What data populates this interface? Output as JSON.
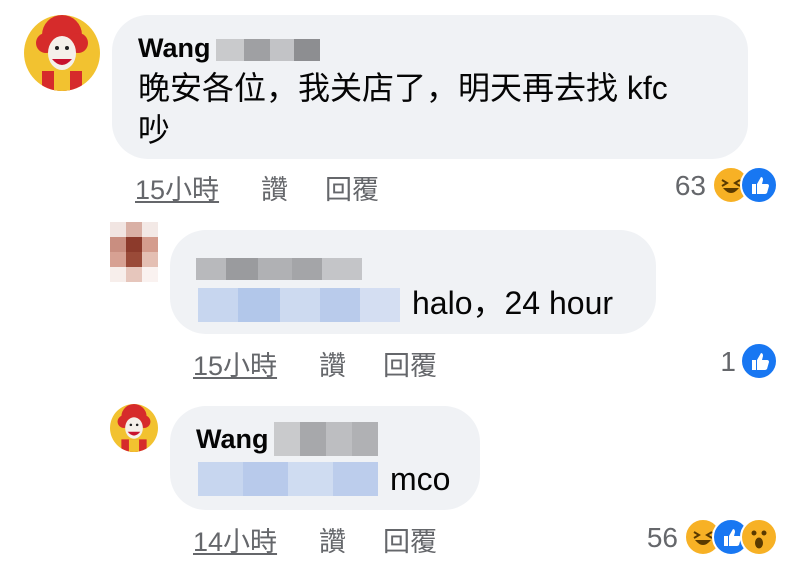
{
  "comments": [
    {
      "author": "Wang",
      "text_line1": "晚安各位，我关店了，明天再去找 kfc",
      "text_line2": "吵",
      "time": "15小時",
      "like": "讚",
      "reply": "回覆",
      "reaction_count": "63",
      "reactions": [
        "haha",
        "like"
      ]
    },
    {
      "author": "",
      "text": "halo，24 hour",
      "time": "15小時",
      "like": "讚",
      "reply": "回覆",
      "reaction_count": "1",
      "reactions": [
        "like"
      ]
    },
    {
      "author": "Wang",
      "text": "mco",
      "time": "14小時",
      "like": "讚",
      "reply": "回覆",
      "reaction_count": "56",
      "reactions": [
        "haha",
        "like",
        "wow"
      ]
    }
  ],
  "colors": {
    "bubble": "#f0f2f5",
    "meta": "#65676b",
    "like_blue": "#1877f2",
    "haha_yellow": "#f7b125"
  }
}
